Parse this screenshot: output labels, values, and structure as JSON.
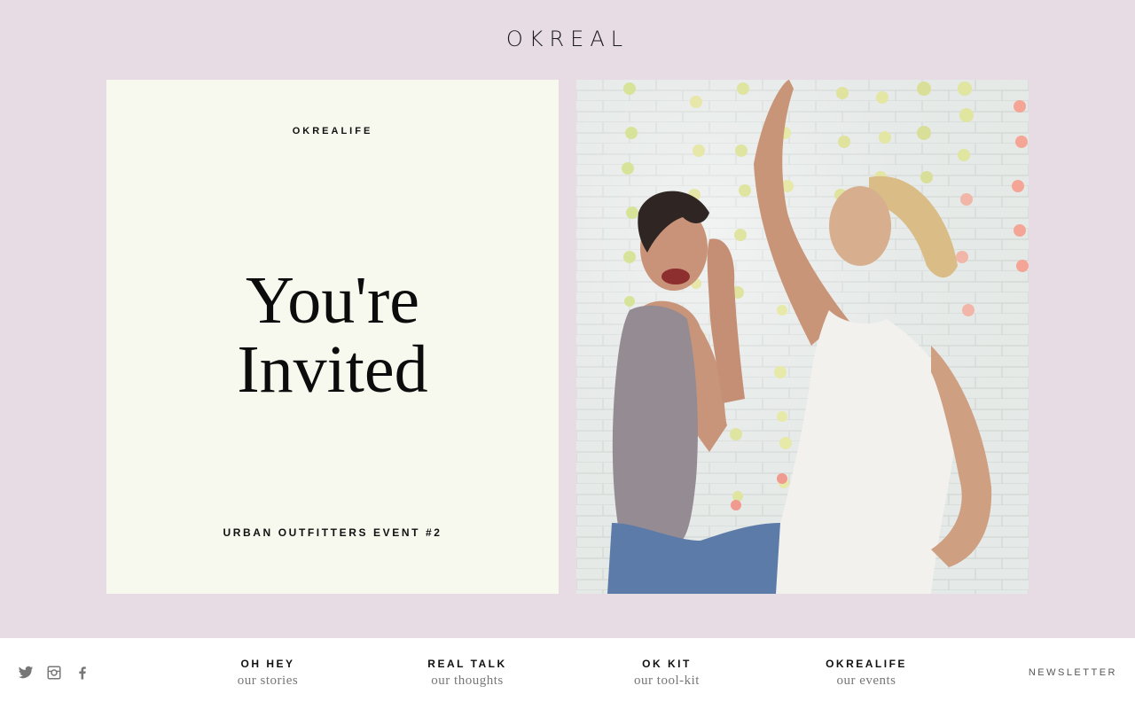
{
  "header": {
    "logo": "OKREAL"
  },
  "feature": {
    "category": "OKREALIFE",
    "headline_line1": "You're",
    "headline_line2": "Invited",
    "subtitle": "URBAN OUTFITTERS EVENT #2"
  },
  "footer": {
    "social": [
      "twitter-icon",
      "instagram-icon",
      "facebook-icon"
    ],
    "nav": [
      {
        "title": "OH HEY",
        "subtitle": "our stories"
      },
      {
        "title": "REAL TALK",
        "subtitle": "our thoughts"
      },
      {
        "title": "OK KIT",
        "subtitle": "our tool-kit"
      },
      {
        "title": "OKREALIFE",
        "subtitle": "our events"
      }
    ],
    "newsletter": "NEWSLETTER"
  },
  "colors": {
    "background": "#e7dce4",
    "card": "#f7f8ee",
    "footer": "#ffffff"
  }
}
